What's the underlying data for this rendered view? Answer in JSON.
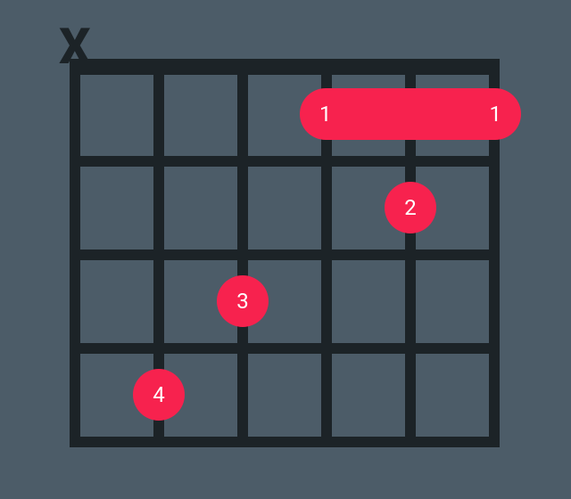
{
  "chord": {
    "muted_label": "X",
    "barre_left_label": "1",
    "barre_right_label": "1",
    "dot2_label": "2",
    "dot3_label": "3",
    "dot4_label": "4"
  },
  "chart_data": {
    "type": "table",
    "title": "Guitar chord diagram",
    "strings": 6,
    "frets_shown": 4,
    "muted_strings": [
      6
    ],
    "open_strings": [],
    "barre": {
      "from_string": 3,
      "to_string": 1,
      "fret": 1,
      "finger": 1
    },
    "fingerings": [
      {
        "string": 2,
        "fret": 2,
        "finger": 2
      },
      {
        "string": 4,
        "fret": 3,
        "finger": 3
      },
      {
        "string": 5,
        "fret": 4,
        "finger": 4
      }
    ],
    "colors": {
      "grid": "#1c2327",
      "marker": "#f7224e",
      "background": "#4c5c68"
    }
  }
}
